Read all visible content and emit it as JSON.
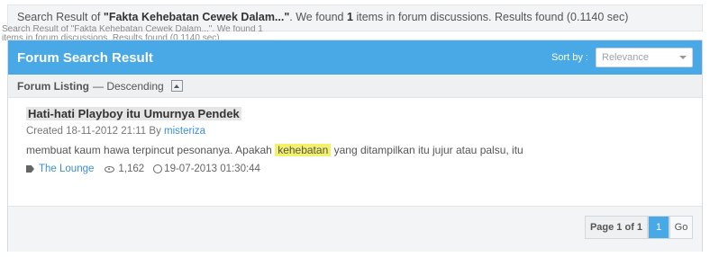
{
  "banner": {
    "prefix": "Search Result of",
    "query": "\"Fakta Kehebatan Cewek Dalam...\"",
    "mid": ". We found",
    "count": "1",
    "suffix": "items in forum discussions. Results found (0.1140 sec)"
  },
  "overlay": {
    "line1": "Search Result of \"Fakta Kehebatan Cewek Dalam...\". We found 1",
    "line2": "items in forum discussions. Results found (0.1140 sec)"
  },
  "header": {
    "title": "Forum Search Result",
    "sort_label": "Sort by :",
    "sort_value": "Relevance"
  },
  "listing": {
    "label": "Forum Listing",
    "order": "— Descending"
  },
  "result": {
    "title": "Hati-hati Playboy itu Umurnya Pendek",
    "created_prefix": "Created 18-11-2012 21:11 By",
    "author": "misteriza",
    "snippet_before": "membuat kaum hawa terpincut pesonanya. Apakah",
    "snippet_highlight": "kehebatan",
    "snippet_after": "yang ditampilkan itu jujur atau palsu, itu",
    "forum": "The Lounge",
    "views": "1,162",
    "last_post": "19-07-2013 01:30:44"
  },
  "pagination": {
    "info": "Page 1 of 1",
    "current": "1",
    "go": "Go"
  },
  "icons": {
    "tag": "tag-icon",
    "views": "eye-icon",
    "time": "clock-icon",
    "sort_toggle": "caret-up-icon",
    "select": "chevron-down-icon"
  },
  "colors": {
    "header": "#48a9e6",
    "link": "#3a8fd0",
    "highlight": "#f3f06a"
  }
}
